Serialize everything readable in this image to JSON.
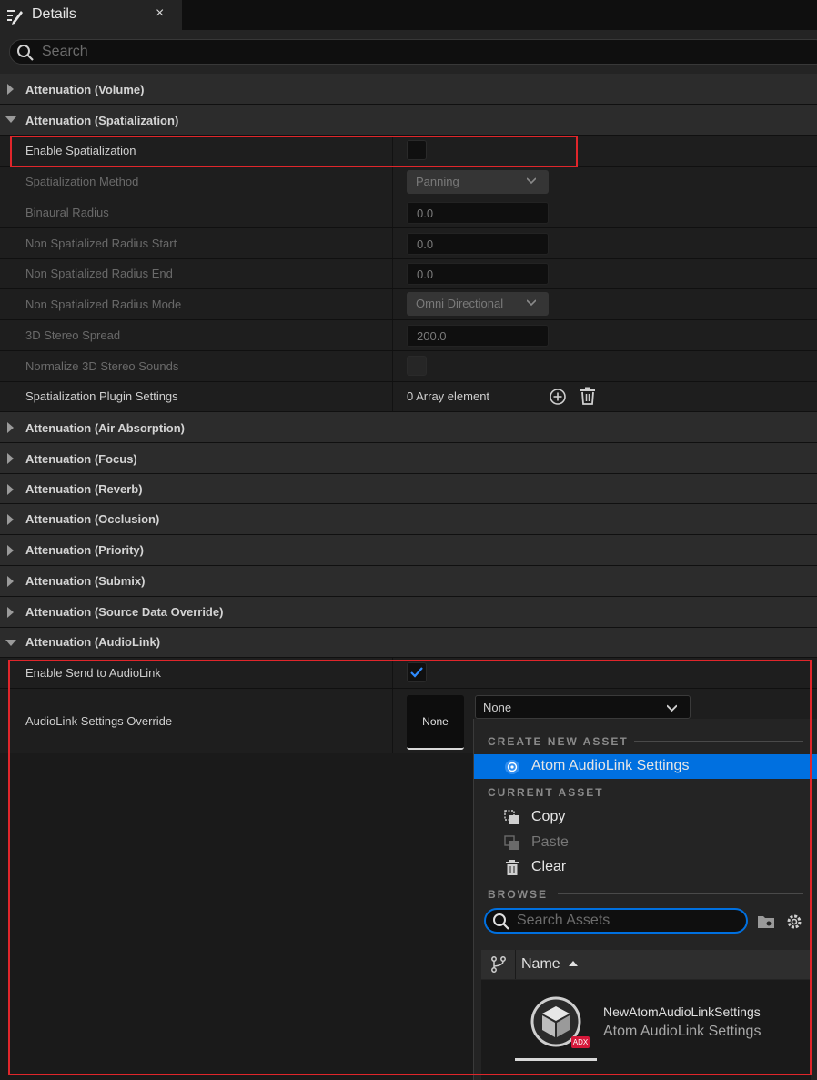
{
  "tab": {
    "title": "Details",
    "close": "×"
  },
  "search": {
    "placeholder": "Search"
  },
  "categories": {
    "volume": "Attenuation (Volume)",
    "spatialization": "Attenuation (Spatialization)",
    "air": "Attenuation (Air Absorption)",
    "focus": "Attenuation (Focus)",
    "reverb": "Attenuation (Reverb)",
    "occlusion": "Attenuation (Occlusion)",
    "priority": "Attenuation (Priority)",
    "submix": "Attenuation (Submix)",
    "source": "Attenuation (Source Data Override)",
    "audiolink": "Attenuation (AudioLink)"
  },
  "props": {
    "enable_spatialization": {
      "label": "Enable Spatialization",
      "checked": false
    },
    "spatialization_method": {
      "label": "Spatialization Method",
      "value": "Panning"
    },
    "binaural_radius": {
      "label": "Binaural Radius",
      "value": "0.0"
    },
    "nonspat_start": {
      "label": "Non Spatialized Radius Start",
      "value": "0.0"
    },
    "nonspat_end": {
      "label": "Non Spatialized Radius End",
      "value": "0.0"
    },
    "nonspat_mode": {
      "label": "Non Spatialized Radius Mode",
      "value": "Omni Directional"
    },
    "stereo_spread": {
      "label": "3D Stereo Spread",
      "value": "200.0"
    },
    "normalize_stereo": {
      "label": "Normalize 3D Stereo Sounds",
      "checked": false
    },
    "plugin_settings": {
      "label": "Spatialization Plugin Settings",
      "value": "0 Array element"
    },
    "enable_send": {
      "label": "Enable Send to AudioLink",
      "checked": true
    },
    "audiolink_override": {
      "label": "AudioLink Settings Override",
      "thumb": "None",
      "value": "None"
    }
  },
  "menu": {
    "create_header": "CREATE NEW ASSET",
    "create_item": "Atom AudioLink Settings",
    "current_header": "CURRENT ASSET",
    "copy": "Copy",
    "paste": "Paste",
    "clear": "Clear",
    "browse_header": "BROWSE",
    "search_placeholder": "Search Assets",
    "column_name": "Name",
    "asset_name": "NewAtomAudioLinkSettings",
    "asset_type": "Atom AudioLink Settings",
    "asset_badge": "ADX"
  },
  "colors": {
    "accent": "#0070e0",
    "highlight": "#e0262b"
  }
}
